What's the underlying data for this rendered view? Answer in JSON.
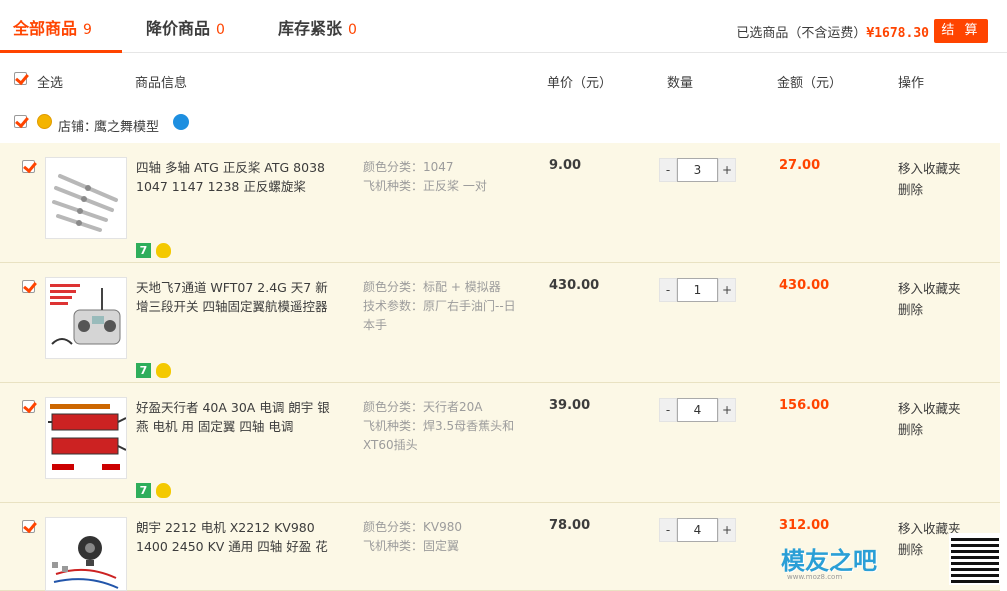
{
  "tabs": [
    {
      "label": "全部商品",
      "count": "9"
    },
    {
      "label": "降价商品",
      "count": "0"
    },
    {
      "label": "库存紧张",
      "count": "0"
    }
  ],
  "summary": {
    "label": "已选商品（不含运费）",
    "price": "¥1678.30",
    "checkout_label": "结 算"
  },
  "header": {
    "select_all": "全选",
    "info": "商品信息",
    "unit_price": "单价（元）",
    "quantity": "数量",
    "amount": "金额（元）",
    "ops": "操作"
  },
  "shop": {
    "label": "店铺：",
    "name": "鹰之舞模型"
  },
  "items": [
    {
      "title": "四轴 多轴 ATG 正反桨 ATG 8038 1047 1147 1238 正反螺旋桨",
      "props": [
        {
          "k": "颜色分类：",
          "v": "1047"
        },
        {
          "k": "飞机种类：",
          "v": "正反桨 一对"
        }
      ],
      "unit_price": "9.00",
      "qty": "3",
      "amount": "27.00"
    },
    {
      "title": "天地飞7通道 WFT07 2.4G 天7 新增三段开关 四轴固定翼航模遥控器",
      "props": [
        {
          "k": "颜色分类：",
          "v": "标配 + 模拟器"
        },
        {
          "k": "技术参数：",
          "v": "原厂右手油门--日本手"
        }
      ],
      "unit_price": "430.00",
      "qty": "1",
      "amount": "430.00"
    },
    {
      "title": "好盈天行者 40A 30A 电调 朗宇 银燕 电机 用 固定翼 四轴 电调",
      "props": [
        {
          "k": "颜色分类：",
          "v": "天行者20A"
        },
        {
          "k": "飞机种类：",
          "v": "焊3.5母香蕉头和XT60插头"
        }
      ],
      "unit_price": "39.00",
      "qty": "4",
      "amount": "156.00"
    },
    {
      "title": "朗宇 2212 电机 X2212 KV980 1400 2450 KV 通用 四轴 好盈 花",
      "props": [
        {
          "k": "颜色分类：",
          "v": "KV980"
        },
        {
          "k": "飞机种类：",
          "v": "固定翼"
        }
      ],
      "unit_price": "78.00",
      "qty": "4",
      "amount": "312.00"
    }
  ],
  "item_ops": {
    "fav": "移入收藏夹",
    "del": "删除"
  },
  "qty_controls": {
    "minus": "-",
    "plus": "+"
  },
  "badge": {
    "seven": "7"
  },
  "watermark": {
    "text": "模友之吧",
    "url": "www.moz8.com"
  }
}
